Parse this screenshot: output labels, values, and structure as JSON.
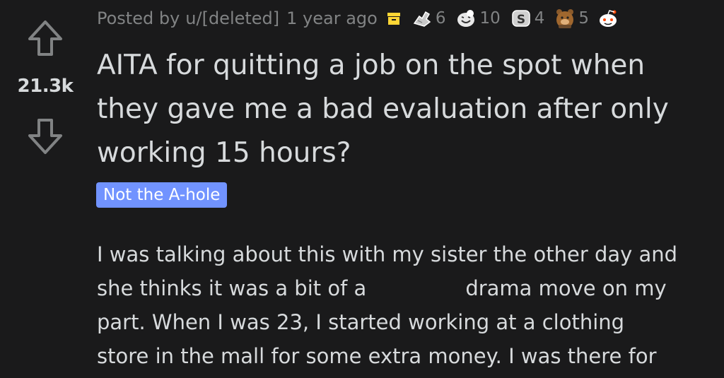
{
  "vote": {
    "score": "21.3k"
  },
  "meta": {
    "prefix": "Posted by",
    "author": "u/[deleted]",
    "age": "1 year ago",
    "awards": [
      {
        "icon": "wholesome-hands-award-icon",
        "count": "6"
      },
      {
        "icon": "laughing-award-icon",
        "count": "10"
      },
      {
        "icon": "silver-award-icon",
        "count": "4"
      },
      {
        "icon": "bear-award-icon",
        "count": "5"
      }
    ]
  },
  "post": {
    "title_lines": [
      "AITA for quitting a job on the spot when",
      "they gave me a bad evaluation after only",
      "working 15 hours?"
    ],
    "flair": "Not the A-hole",
    "body_lines": [
      "I was talking about this with my sister the other day and",
      "she thinks it was a bit of a",
      "drama move on my",
      "part. When I was 23, I started working at a clothing",
      "store in the mall for some extra money. I was there for"
    ]
  },
  "colors": {
    "background": "#1a1a1b",
    "text": "#d7dadc",
    "meta": "#818384",
    "flair": "#7193ff",
    "archive": "#ffd635"
  }
}
